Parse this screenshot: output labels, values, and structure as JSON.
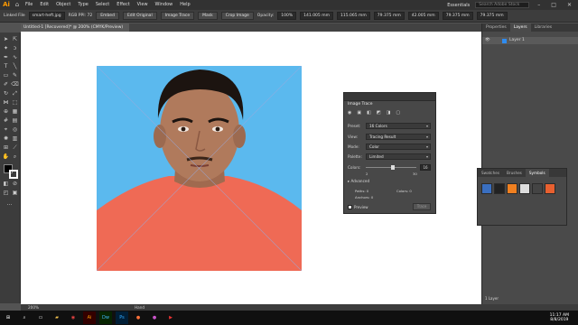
{
  "app": {
    "logo": "Ai"
  },
  "menu": [
    "File",
    "Edit",
    "Object",
    "Type",
    "Select",
    "Effect",
    "View",
    "Window",
    "Help"
  ],
  "workspace": "Essentials",
  "search_placeholder": "Search Adobe Stock",
  "control_bar": {
    "linked_file_label": "Linked File",
    "file_name": "smart-heft.jpg",
    "color_mode": "RGB  PPI: 72",
    "embed_label": "Embed",
    "edit_original_label": "Edit Original",
    "image_trace_label": "Image Trace",
    "mask_label": "Mask",
    "crop_image_label": "Crop Image",
    "opacity_label": "Opacity:",
    "opacity_value": "100%",
    "x_value": "141.005 mm",
    "y_value": "115.065 mm",
    "w_value": "79.375 mm",
    "h_value": "42.005 mm",
    "w2_value": "79.375 mm",
    "h2_value": "79.375 mm"
  },
  "document_tab": "Untitled-1 [Recovered]* @ 200% (CMYK/Preview)",
  "image_trace_panel": {
    "title": "Image Trace",
    "preset_label": "Preset:",
    "preset_value": "16 Colors",
    "view_label": "View:",
    "view_value": "Tracing Result",
    "mode_label": "Mode:",
    "mode_value": "Color",
    "palette_label": "Palette:",
    "palette_value": "Limited",
    "colors_label": "Colors:",
    "colors_value": "16",
    "colors_min": "2",
    "colors_max": "30",
    "advanced_label": "Advanced",
    "paths_label": "Paths: 0",
    "colors_count_label": "Colors: 0",
    "anchors_label": "Anchors: 0",
    "preview_label": "Preview",
    "trace_label": "Trace"
  },
  "right_panel": {
    "tabs": [
      "Properties",
      "Layers",
      "Libraries"
    ],
    "active_tab": "Layers",
    "layer_name": "Layer 1",
    "footer": "1 Layer"
  },
  "symbols_panel": {
    "tabs": [
      "Swatches",
      "Brushes",
      "Symbols"
    ],
    "active_tab": "Symbols"
  },
  "status_bar": {
    "zoom": "200%",
    "tool": "Hand"
  },
  "taskbar": {
    "time": "11:17 AM",
    "date": "8/8/2019"
  },
  "colors": {
    "artboard_bg": "#5bb9ee",
    "shirt": "#ef6a55",
    "skin": "#b07a5c",
    "hair": "#1c1410"
  }
}
